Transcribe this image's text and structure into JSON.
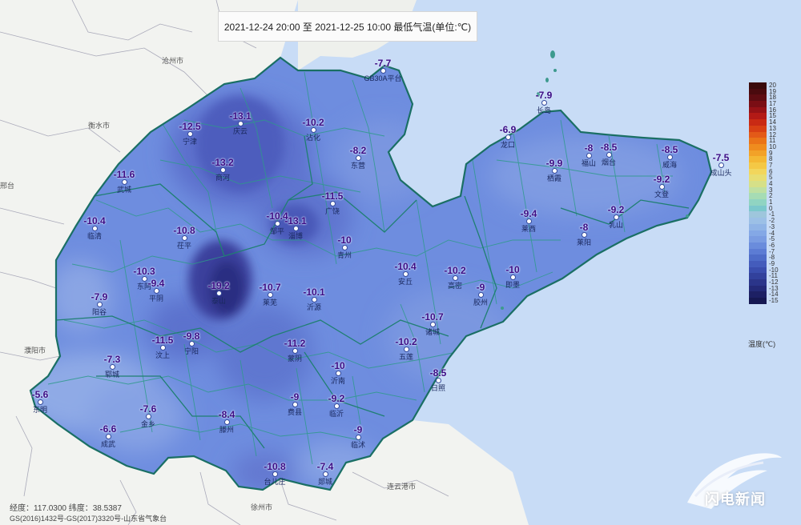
{
  "title": "2021-12-24 20:00 至 2021-12-25 10:00 最低气温(单位:℃)",
  "stations": [
    {
      "value": "-7.7",
      "name": "GB30A平台"
    },
    {
      "value": "-13.1",
      "name": "庆云"
    },
    {
      "value": "-10.2",
      "name": "沾化"
    },
    {
      "value": "-12.5",
      "name": "宁津"
    },
    {
      "value": "-8.2",
      "name": "东营"
    },
    {
      "value": "-13.2",
      "name": "商河"
    },
    {
      "value": "-11.6",
      "name": "武城"
    },
    {
      "value": "-11.5",
      "name": "广饶"
    },
    {
      "value": "-10.4",
      "name": "邹平"
    },
    {
      "value": "-13.1",
      "name": "淄博"
    },
    {
      "value": "-10.4",
      "name": "临清"
    },
    {
      "value": "-10.8",
      "name": "茌平"
    },
    {
      "value": "-10",
      "name": "青州"
    },
    {
      "value": "-10.3",
      "name": "东阿"
    },
    {
      "value": "-9.4",
      "name": "平阴"
    },
    {
      "value": "-19.2",
      "name": "泰山"
    },
    {
      "value": "-10.7",
      "name": "莱芜"
    },
    {
      "value": "-10.1",
      "name": "沂源"
    },
    {
      "value": "-7.9",
      "name": "阳谷"
    },
    {
      "value": "-10.4",
      "name": "安丘"
    },
    {
      "value": "-10.2",
      "name": "高密"
    },
    {
      "value": "-10",
      "name": "即墨"
    },
    {
      "value": "-9",
      "name": "胶州"
    },
    {
      "value": "-10.7",
      "name": "诸城"
    },
    {
      "value": "-11.5",
      "name": "汶上"
    },
    {
      "value": "-9.8",
      "name": "宁阳"
    },
    {
      "value": "-11.2",
      "name": "蒙阴"
    },
    {
      "value": "-10.2",
      "name": "五莲"
    },
    {
      "value": "-7.3",
      "name": "郓城"
    },
    {
      "value": "-10",
      "name": "沂南"
    },
    {
      "value": "-8.5",
      "name": "日照"
    },
    {
      "value": "-5.6",
      "name": "东明"
    },
    {
      "value": "-7.6",
      "name": "金乡"
    },
    {
      "value": "-9",
      "name": "费县"
    },
    {
      "value": "-9.2",
      "name": "临沂"
    },
    {
      "value": "-8.4",
      "name": "滕州"
    },
    {
      "value": "-6.6",
      "name": "成武"
    },
    {
      "value": "-9",
      "name": "临沭"
    },
    {
      "value": "-10.8",
      "name": "台儿庄"
    },
    {
      "value": "-7.4",
      "name": "郯城"
    },
    {
      "value": "-7.9",
      "name": "长岛"
    },
    {
      "value": "-6.9",
      "name": "龙口"
    },
    {
      "value": "-8",
      "name": "福山"
    },
    {
      "value": "-8.5",
      "name": "烟台"
    },
    {
      "value": "-8.5",
      "name": "威海"
    },
    {
      "value": "-7.5",
      "name": "成山头"
    },
    {
      "value": "-9.9",
      "name": "栖霞"
    },
    {
      "value": "-9.2",
      "name": "文登"
    },
    {
      "value": "-9.4",
      "name": "莱西"
    },
    {
      "value": "-8",
      "name": "莱阳"
    },
    {
      "value": "-9.2",
      "name": "乳山"
    }
  ],
  "cities": [
    "沧州市",
    "衡水市",
    "邢台",
    "濮阳市",
    "连云港市",
    "徐州市"
  ],
  "legend": {
    "title": "温度(℃)",
    "ticks": [
      "20",
      "19",
      "18",
      "17",
      "16",
      "15",
      "14",
      "13",
      "12",
      "11",
      "10",
      "9",
      "8",
      "7",
      "6",
      "5",
      "4",
      "3",
      "2",
      "1",
      "0",
      "-1",
      "-2",
      "-3",
      "-4",
      "-5",
      "-6",
      "-7",
      "-8",
      "-9",
      "-10",
      "-11",
      "-12",
      "-13",
      "-14",
      "-15"
    ],
    "colors": [
      "#3a0a0a",
      "#4a0a0e",
      "#5e0c12",
      "#7a0e14",
      "#961216",
      "#b31a16",
      "#c92a14",
      "#d84014",
      "#e35a18",
      "#ea7418",
      "#ef8c1e",
      "#f2a228",
      "#f4b834",
      "#f4c845",
      "#f2d65c",
      "#e8de72",
      "#d6e088",
      "#bfe0a2",
      "#a6dcb4",
      "#90d4c2",
      "#7cc8cc",
      "#9ec6dc",
      "#9cc0e6",
      "#90b4e6",
      "#84a8e6",
      "#7a9ce2",
      "#6a8cdc",
      "#5c7cd4",
      "#4e6cc8",
      "#445cbc",
      "#3a4eae",
      "#32419c",
      "#2b358a",
      "#242a78",
      "#1d2064",
      "#161852"
    ]
  },
  "info": {
    "coords": "经度：117.0300  纬度：38.5387",
    "credit": "GS(2016)1432号-GS(2017)3320号-山东省气象台"
  },
  "logo": {
    "text": "闪电新闻"
  }
}
